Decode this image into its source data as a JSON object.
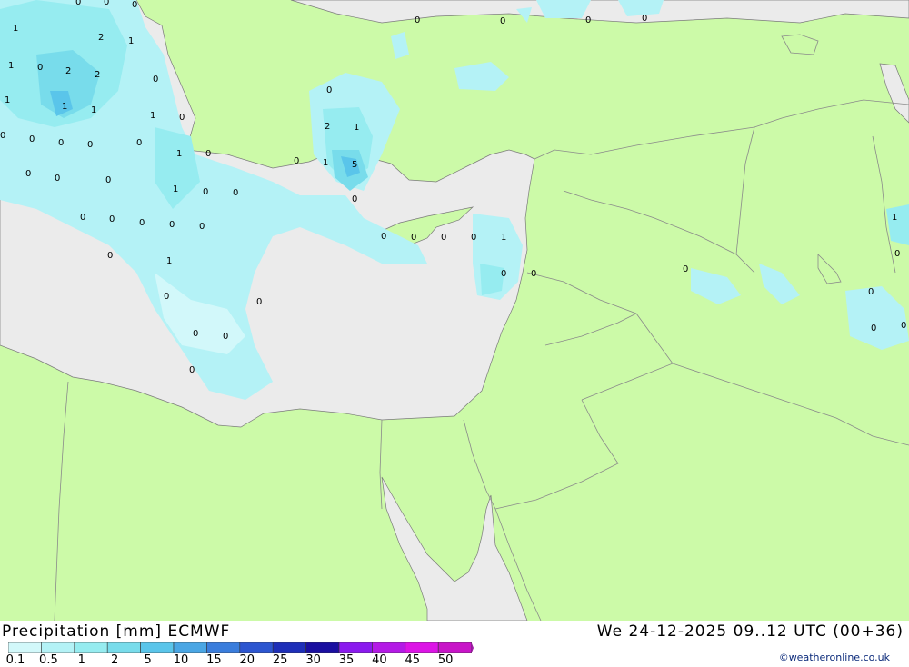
{
  "title": {
    "left": "Precipitation [mm] ECMWF",
    "right": "We 24-12-2025 09..12 UTC (00+36)"
  },
  "credit": "©weatheronline.co.uk",
  "colors": {
    "sea": "#ebebeb",
    "land": "#ccfaa8",
    "border": "#8a8a8a",
    "coast": "#7a7a7a"
  },
  "legend": {
    "labels": [
      "0.1",
      "0.5",
      "1",
      "2",
      "5",
      "10",
      "15",
      "20",
      "25",
      "30",
      "35",
      "40",
      "45",
      "50"
    ],
    "colors": [
      "#d2f8fa",
      "#b4f2f6",
      "#96ecf0",
      "#78dceb",
      "#5ac5ea",
      "#4aa6e4",
      "#3a7ddc",
      "#2d56d0",
      "#1e2fb8",
      "#1a0fa0",
      "#8a1aee",
      "#b41ae6",
      "#dc14e6",
      "#c814c8"
    ],
    "arrow_color": "#a01aa8"
  },
  "values": [
    "1",
    "2",
    "1",
    "0",
    "0",
    "0",
    "1",
    "0",
    "2",
    "2",
    "1",
    "1",
    "1",
    "0",
    "0",
    "0",
    "0",
    "0",
    "1",
    "0",
    "0",
    "0",
    "1",
    "0",
    "0",
    "0",
    "0",
    "0",
    "0",
    "0",
    "0",
    "1",
    "0",
    "0",
    "0",
    "0",
    "0",
    "0",
    "0",
    "0",
    "0",
    "0",
    "0",
    "0",
    "1",
    "2",
    "1",
    "1",
    "5",
    "0",
    "0",
    "0",
    "0",
    "0",
    "1",
    "0",
    "0",
    "0",
    "1",
    "0",
    "0",
    "0",
    "0",
    "0",
    "0"
  ]
}
